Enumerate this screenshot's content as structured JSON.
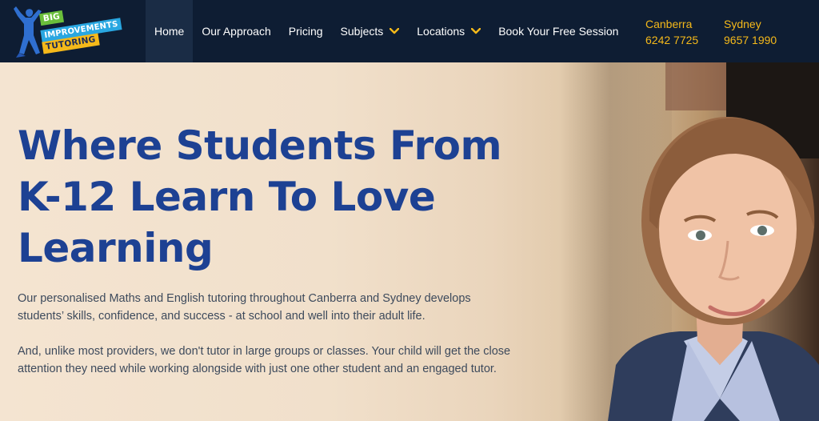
{
  "logo": {
    "line1": "BIG",
    "line2": "IMPROVEMENTS",
    "line3": "TUTORING",
    "colors": {
      "green": "#6abf3b",
      "blue": "#29a7e1",
      "yellow": "#f5b91a"
    }
  },
  "nav": {
    "items": [
      {
        "label": "Home",
        "active": true
      },
      {
        "label": "Our Approach"
      },
      {
        "label": "Pricing"
      },
      {
        "label": "Subjects",
        "dropdown": true
      },
      {
        "label": "Locations",
        "dropdown": true
      },
      {
        "label": "Book Your Free Session"
      }
    ]
  },
  "contacts": {
    "canberra": {
      "city": "Canberra",
      "phone": "6242 7725"
    },
    "sydney": {
      "city": "Sydney",
      "phone": "9657 1990"
    }
  },
  "hero": {
    "headline_line1": "Where Students From",
    "headline_line2": "K-12 Learn To Love",
    "headline_line3": "Learning",
    "paragraph1": "Our personalised Maths and English tutoring throughout Canberra and Sydney develops students’ skills, confidence, and success - at school and well into their adult life.",
    "paragraph2": "And, unlike most providers, we don't tutor in large groups or classes. Your child will get the close attention they need while working alongside with just one other student and an engaged tutor."
  },
  "colors": {
    "nav_bg": "#0e1d33",
    "accent": "#f5b91a",
    "headline": "#1d4193",
    "body_text": "#3d4a5c"
  }
}
